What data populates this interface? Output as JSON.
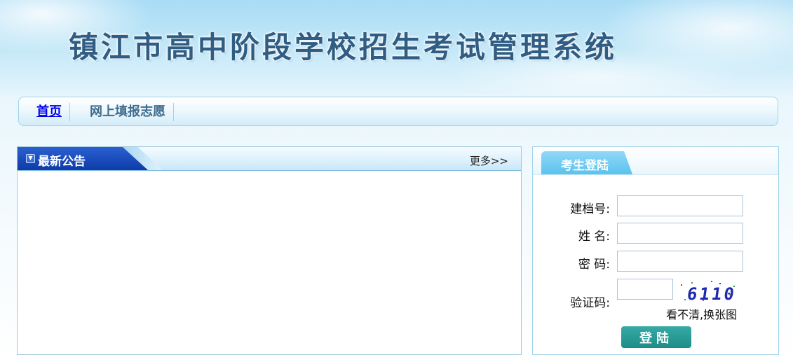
{
  "site": {
    "title": "镇江市高中阶段学校招生考试管理系统"
  },
  "nav": {
    "items": [
      {
        "label": "首页"
      },
      {
        "label": "网上填报志愿"
      }
    ]
  },
  "notices": {
    "title": "最新公告",
    "more_label": "更多>>"
  },
  "login": {
    "tab_title": "考生登陆",
    "fields": {
      "archive_no": "建档号:",
      "name": "姓 名:",
      "password": "密 码:",
      "captcha": "验证码:"
    },
    "captcha_code": "6110",
    "refresh_label": "看不清,换张图",
    "submit_label": "登陆"
  },
  "colors": {
    "accent": "#0e3ca8",
    "button": "#1d8d87",
    "border": "#9fd3ea"
  }
}
